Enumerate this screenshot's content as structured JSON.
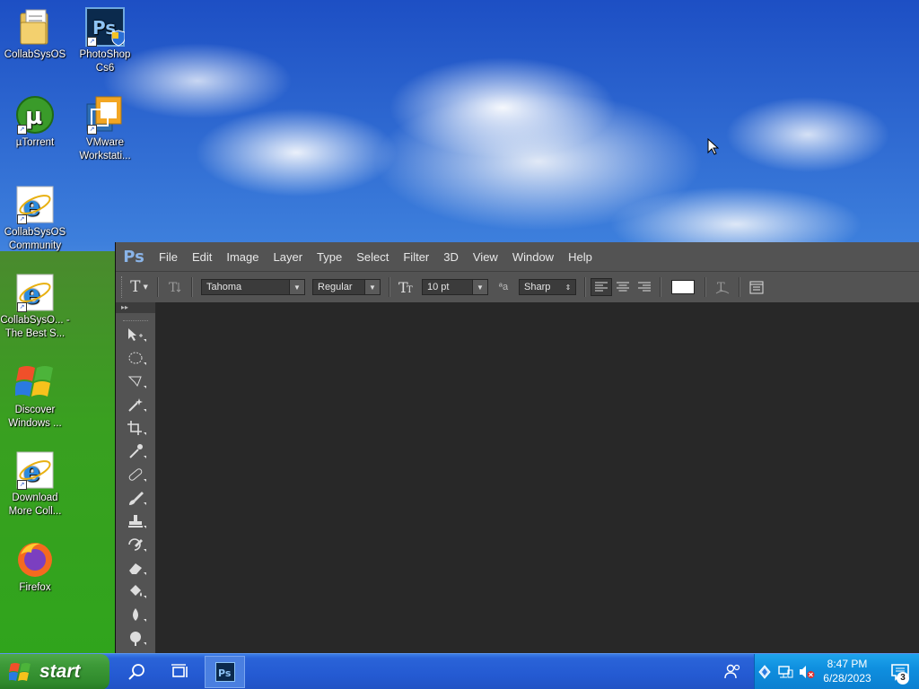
{
  "desktop": {
    "icons": [
      {
        "label": "CollabSysOS",
        "icon": "folder-icon"
      },
      {
        "label": "PhotoShop Cs6",
        "icon": "photoshop-icon"
      },
      {
        "label": "µTorrent",
        "icon": "utorrent-icon"
      },
      {
        "label": "VMware Workstati...",
        "icon": "vmware-icon"
      },
      {
        "label": "CollabSysOS Community",
        "icon": "internet-explorer-icon"
      },
      {
        "label": "CollabSysO... - The Best S...",
        "icon": "internet-explorer-icon"
      },
      {
        "label": "Discover Windows ...",
        "icon": "windows-xp-logo-icon"
      },
      {
        "label": "Download More Coll...",
        "icon": "internet-explorer-icon"
      },
      {
        "label": "Firefox",
        "icon": "firefox-icon"
      }
    ]
  },
  "photoshop": {
    "logo": "Ps",
    "menu": [
      "File",
      "Edit",
      "Image",
      "Layer",
      "Type",
      "Select",
      "Filter",
      "3D",
      "View",
      "Window",
      "Help"
    ],
    "options": {
      "tool_glyph": "T",
      "font_family": "Tahoma",
      "font_style": "Regular",
      "font_size": "10 pt",
      "aa_label": "ªa",
      "antialias": "Sharp"
    },
    "toolbar_head": "▸▸",
    "tools": [
      "move-tool",
      "marquee-tool",
      "lasso-tool",
      "magic-wand-tool",
      "crop-tool",
      "eyedropper-tool",
      "healing-brush-tool",
      "brush-tool",
      "clone-stamp-tool",
      "history-brush-tool",
      "eraser-tool",
      "paint-bucket-tool",
      "blur-tool",
      "dodge-tool"
    ]
  },
  "taskbar": {
    "start_label": "start",
    "clock_time": "8:47 PM",
    "clock_date": "6/28/2023",
    "notification_count": "3"
  },
  "colors": {
    "ps_bg": "#282828",
    "ps_chrome": "#535353",
    "taskbar": "#245ad2",
    "start_green": "#3d9a38",
    "tray": "#0f8fdf"
  }
}
